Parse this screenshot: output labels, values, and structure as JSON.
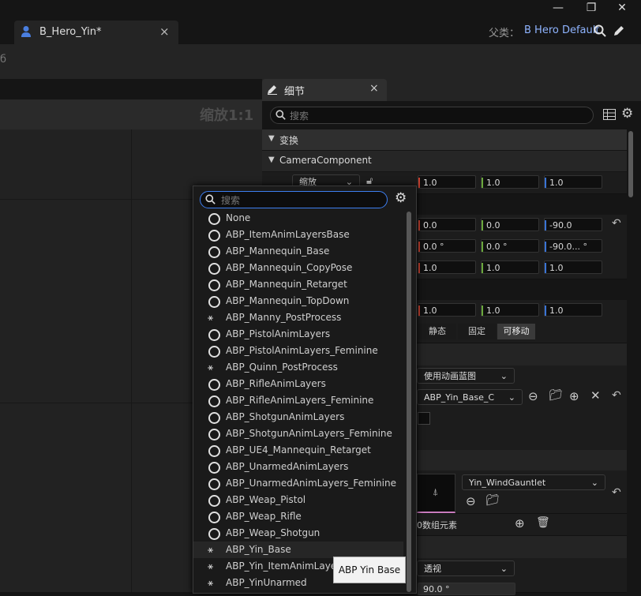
{
  "window": {
    "tab_title": "B_Hero_Yin*",
    "tab_close": "×",
    "minimize": "—",
    "restore": "❐",
    "close": "✕",
    "parent_label": "父类：",
    "parent_value": "B Hero Default",
    "search_icon": "search-icon",
    "edit_icon": "pencil-icon"
  },
  "toolbar": {
    "fragment": "б"
  },
  "viewport": {
    "zoom": "缩放1:1"
  },
  "details": {
    "title": "细节",
    "close": "×",
    "search_placeholder": "搜索",
    "sections": {
      "transform": "变换",
      "camera": "CameraComponent"
    },
    "scale_dropdown": "缩放",
    "rows": {
      "scale": [
        "1.0",
        "1.0",
        "1.0"
      ],
      "location": [
        "0.0",
        "0.0",
        "-90.0"
      ],
      "rotation": [
        "0.0 °",
        "0.0 °",
        "-90.0... °"
      ],
      "scale2": [
        "1.0",
        "1.0",
        "1.0"
      ],
      "scale3": [
        "1.0",
        "1.0",
        "1.0"
      ]
    },
    "mobility": [
      "静态",
      "固定",
      "可移动"
    ],
    "anim_mode": "使用动画蓝图",
    "anim_class": "ABP_Yin_Base_C",
    "mesh": "Yin_WindGauntlet",
    "array_elements": "0数组元素",
    "projection": "透视",
    "fov": "90.0 °",
    "reset_icon": "↶"
  },
  "popup": {
    "search_placeholder": "搜索",
    "items": [
      {
        "label": "None",
        "icon": "circle"
      },
      {
        "label": "ABP_ItemAnimLayersBase",
        "icon": "circle"
      },
      {
        "label": "ABP_Mannequin_Base",
        "icon": "circle"
      },
      {
        "label": "ABP_Mannequin_CopyPose",
        "icon": "circle"
      },
      {
        "label": "ABP_Mannequin_Retarget",
        "icon": "circle"
      },
      {
        "label": "ABP_Mannequin_TopDown",
        "icon": "circle"
      },
      {
        "label": "ABP_Manny_PostProcess",
        "icon": "anim"
      },
      {
        "label": "ABP_PistolAnimLayers",
        "icon": "circle"
      },
      {
        "label": "ABP_PistolAnimLayers_Feminine",
        "icon": "circle"
      },
      {
        "label": "ABP_Quinn_PostProcess",
        "icon": "anim"
      },
      {
        "label": "ABP_RifleAnimLayers",
        "icon": "circle"
      },
      {
        "label": "ABP_RifleAnimLayers_Feminine",
        "icon": "circle"
      },
      {
        "label": "ABP_ShotgunAnimLayers",
        "icon": "circle"
      },
      {
        "label": "ABP_ShotgunAnimLayers_Feminine",
        "icon": "circle"
      },
      {
        "label": "ABP_UE4_Mannequin_Retarget",
        "icon": "circle"
      },
      {
        "label": "ABP_UnarmedAnimLayers",
        "icon": "circle"
      },
      {
        "label": "ABP_UnarmedAnimLayers_Feminine",
        "icon": "circle"
      },
      {
        "label": "ABP_Weap_Pistol",
        "icon": "circle"
      },
      {
        "label": "ABP_Weap_Rifle",
        "icon": "circle"
      },
      {
        "label": "ABP_Weap_Shotgun",
        "icon": "circle"
      },
      {
        "label": "ABP_Yin_Base",
        "icon": "anim"
      },
      {
        "label": "ABP_Yin_ItemAnimLayers",
        "icon": "anim"
      },
      {
        "label": "ABP_YinUnarmed",
        "icon": "anim"
      }
    ],
    "tooltip": "ABP Yin Base"
  }
}
